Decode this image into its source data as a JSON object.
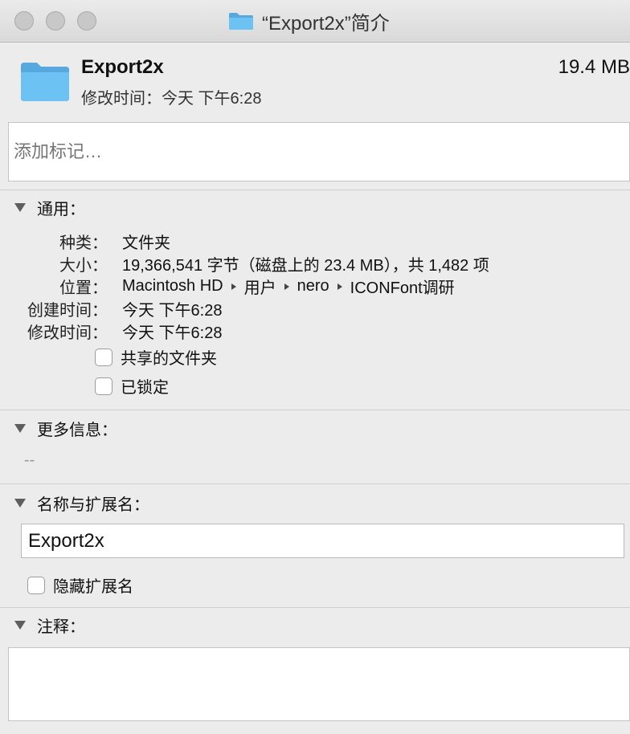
{
  "window": {
    "title": "“Export2x”简介"
  },
  "header": {
    "name": "Export2x",
    "size": "19.4 MB",
    "modified": "修改时间：今天 下午6:28",
    "tags_placeholder": "添加标记…"
  },
  "general": {
    "title": "通用：",
    "kind_label": "种类：",
    "kind_value": "文件夹",
    "size_label": "大小：",
    "size_value": "19,366,541 字节（磁盘上的 23.4 MB），共 1,482 项",
    "where_label": "位置：",
    "where_path": [
      "Macintosh HD",
      "用户",
      "nero",
      "ICONFont调研"
    ],
    "created_label": "创建时间：",
    "created_value": "今天 下午6:28",
    "modified_label": "修改时间：",
    "modified_value": "今天 下午6:28",
    "shared_folder": "共享的文件夹",
    "locked": "已锁定"
  },
  "more_info": {
    "title": "更多信息：",
    "value": "--"
  },
  "name_ext": {
    "title": "名称与扩展名：",
    "value": "Export2x",
    "hide_ext": "隐藏扩展名"
  },
  "comments": {
    "title": "注释："
  },
  "colors": {
    "folder": "#6cc2f2",
    "folder_dark": "#55a9de"
  }
}
